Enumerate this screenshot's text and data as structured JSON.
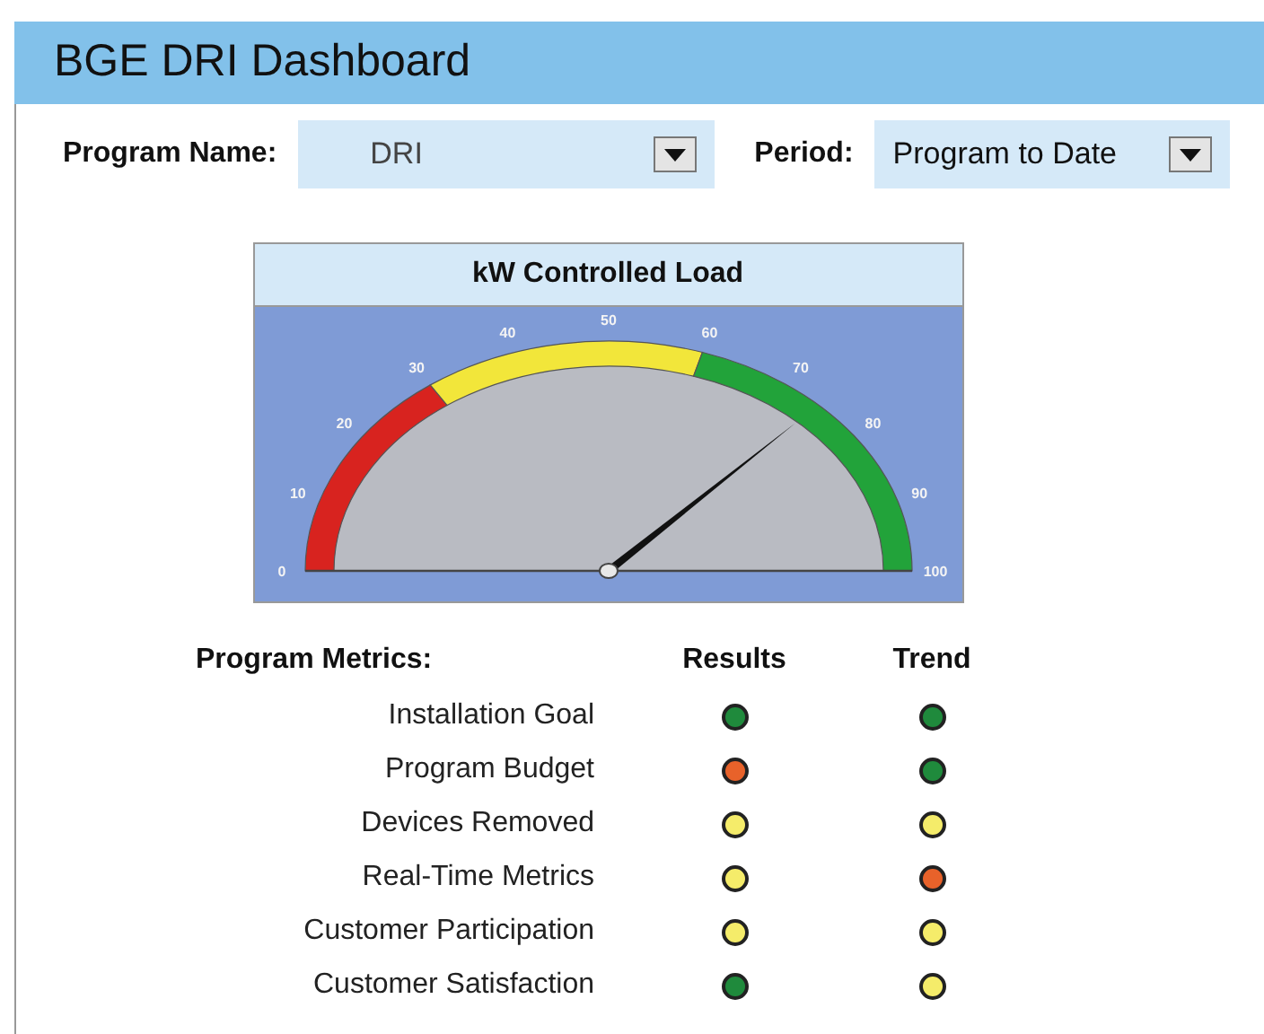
{
  "header": {
    "title": "BGE DRI Dashboard"
  },
  "filters": [
    {
      "label": "Program Name:",
      "value": "DRI"
    },
    {
      "label": "Period:",
      "value": "Program to Date"
    }
  ],
  "gauge": {
    "title": "kW Controlled Load",
    "level": 0.74,
    "ticks": [
      "0",
      "10",
      "20",
      "30",
      "40",
      "50",
      "60",
      "70",
      "80",
      "90",
      "100"
    ]
  },
  "metrics": {
    "columns": [
      "Program Metrics:",
      "Results",
      "Trend"
    ],
    "rows": [
      {
        "label": "Installation Goal",
        "result": {
          "color": "#1f8a3c"
        },
        "trend": {
          "color": "#1f8a3c"
        }
      },
      {
        "label": "Program Budget",
        "result": {
          "color": "#e8622a"
        },
        "trend": {
          "color": "#1f8a3c"
        }
      },
      {
        "label": "Devices Removed",
        "result": {
          "color": "#f5ec6a"
        },
        "trend": {
          "color": "#f5ec6a"
        }
      },
      {
        "label": "Real-Time Metrics",
        "result": {
          "color": "#f5ec6a"
        },
        "trend": {
          "color": "#e8622a"
        }
      },
      {
        "label": "Customer Participation",
        "result": {
          "color": "#f5ec6a"
        },
        "trend": {
          "color": "#f5ec6a"
        }
      },
      {
        "label": "Customer Satisfaction",
        "result": {
          "color": "#1f8a3c"
        },
        "trend": {
          "color": "#f5ec6a"
        }
      }
    ]
  }
}
